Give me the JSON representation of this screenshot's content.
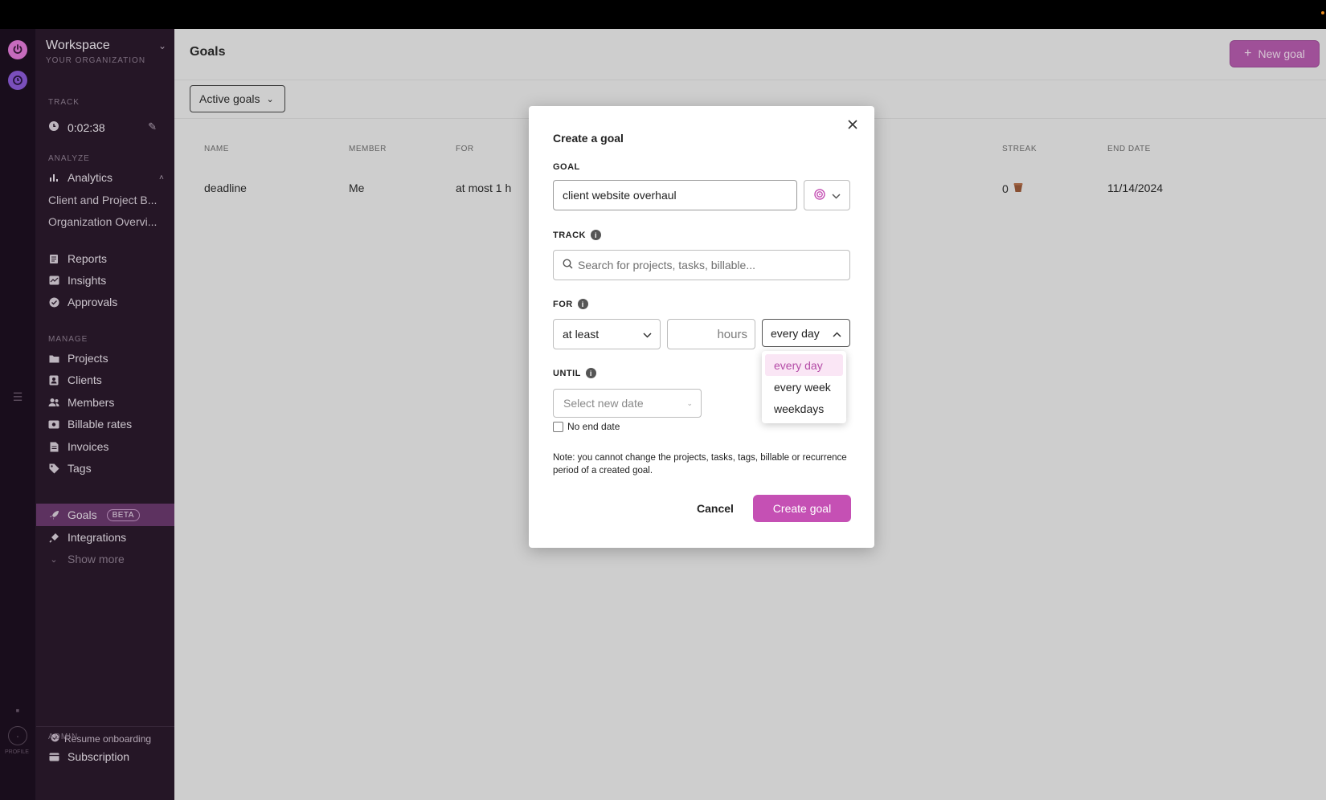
{
  "sidebar": {
    "workspace_title": "Workspace",
    "workspace_subtitle": "YOUR ORGANIZATION",
    "track_label": "TRACK",
    "timer": "0:02:38",
    "analyze_label": "ANALYZE",
    "analytics": "Analytics",
    "client_project": "Client and Project B...",
    "org_overview": "Organization Overvi...",
    "reports": "Reports",
    "insights": "Insights",
    "approvals": "Approvals",
    "manage_label": "MANAGE",
    "projects": "Projects",
    "clients": "Clients",
    "members": "Members",
    "billable_rates": "Billable rates",
    "invoices": "Invoices",
    "tags": "Tags",
    "goals": "Goals",
    "goals_badge": "BETA",
    "integrations": "Integrations",
    "show_more": "Show more",
    "resume_onboarding": "Resume onboarding",
    "admin_label": "ADMIN",
    "subscription": "Subscription",
    "profile_label": "PROFILE"
  },
  "main": {
    "title": "Goals",
    "new_goal": "New goal",
    "filter": "Active goals",
    "columns": {
      "name": "NAME",
      "member": "MEMBER",
      "for": "FOR",
      "streak": "STREAK",
      "end_date": "END DATE"
    },
    "row": {
      "name": "deadline",
      "member": "Me",
      "for": "at most 1 h",
      "streak": "0",
      "end_date": "11/14/2024"
    }
  },
  "modal": {
    "title": "Create a goal",
    "goal_label": "GOAL",
    "goal_value": "client website overhaul",
    "track_label": "TRACK",
    "track_placeholder": "Search for projects, tasks, billable...",
    "for_label": "FOR",
    "comparator": "at least",
    "hours_placeholder": "hours",
    "period": "every day",
    "period_options": [
      "every day",
      "every week",
      "weekdays"
    ],
    "until_label": "UNTIL",
    "date_placeholder": "Select new date",
    "no_end_date": "No end date",
    "note": "Note: you cannot change the projects, tasks, tags, billable or recurrence period of a created goal.",
    "cancel": "Cancel",
    "create": "Create goal"
  },
  "colors": {
    "accent": "#c550b4",
    "sidebar_bg": "#2b1a2c",
    "active_nav": "#6a3a6e"
  }
}
